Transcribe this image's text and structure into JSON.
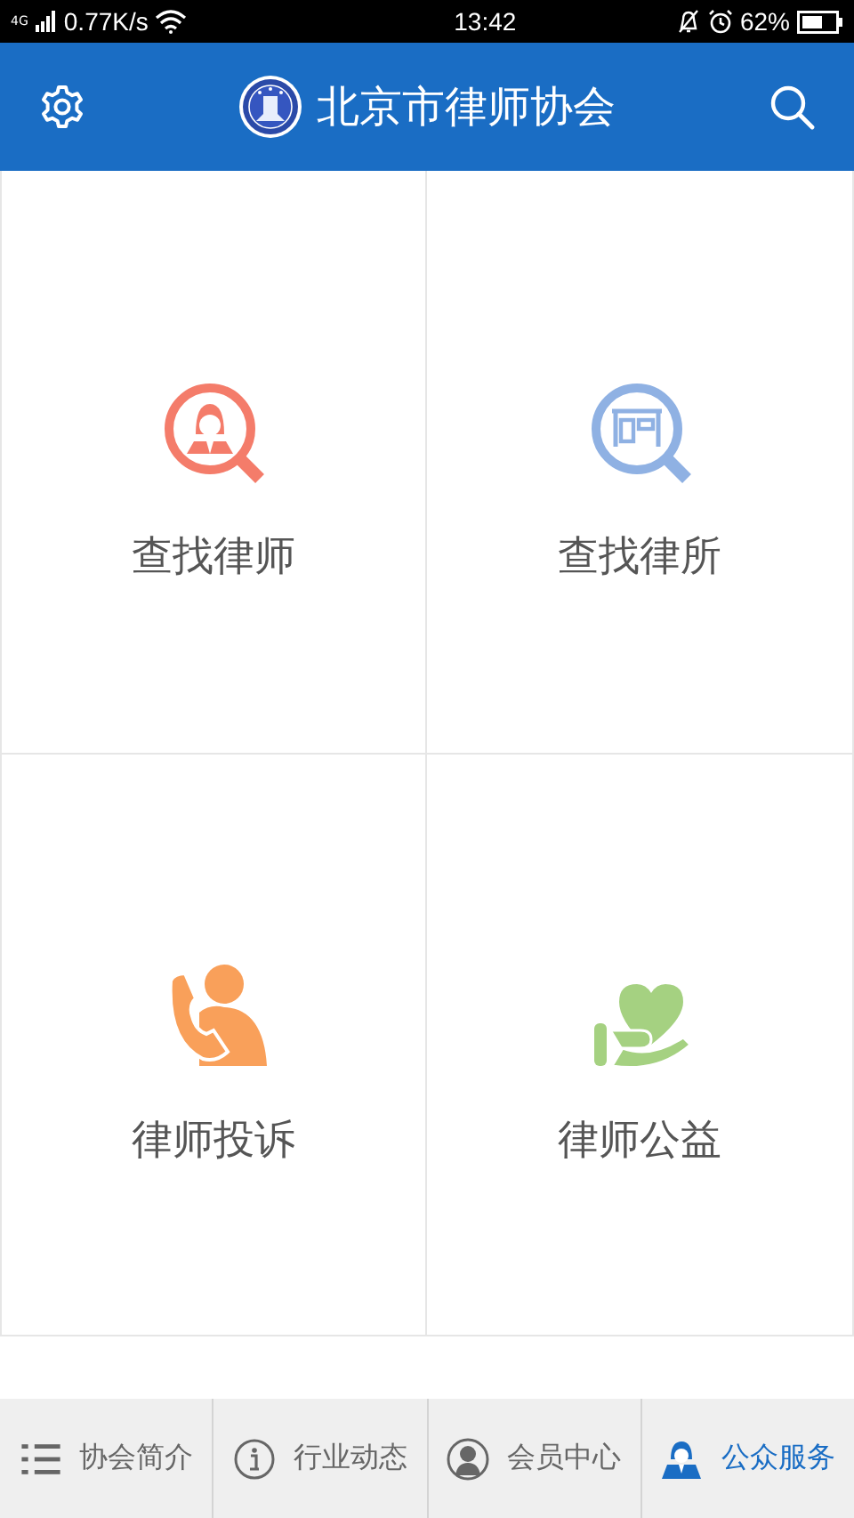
{
  "status_bar": {
    "network": "4G",
    "speed": "0.77K/s",
    "time": "13:42",
    "battery": "62%"
  },
  "header": {
    "title": "北京市律师协会"
  },
  "tiles": [
    {
      "label": "查找律师"
    },
    {
      "label": "查找律所"
    },
    {
      "label": "律师投诉"
    },
    {
      "label": "律师公益"
    }
  ],
  "tabs": [
    {
      "label": "协会简介",
      "selected": false
    },
    {
      "label": "行业动态",
      "selected": false
    },
    {
      "label": "会员中心",
      "selected": false
    },
    {
      "label": "公众服务",
      "selected": true
    }
  ]
}
